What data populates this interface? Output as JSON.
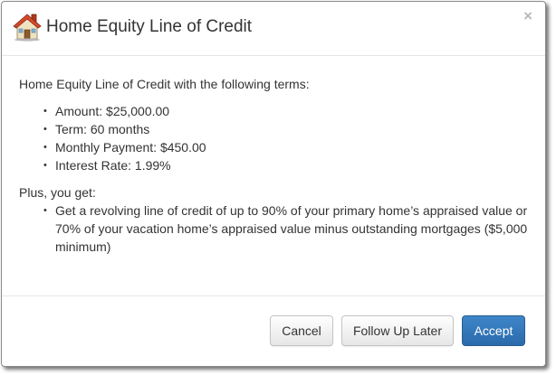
{
  "dialog": {
    "title": "Home Equity Line of Credit",
    "icon": "house-icon",
    "close_label": "×"
  },
  "body": {
    "intro": "Home Equity Line of Credit with the following terms:",
    "terms": [
      "Amount: $25,000.00",
      "Term: 60 months",
      "Monthly Payment: $450.00",
      "Interest Rate: 1.99%"
    ],
    "plus_heading": "Plus, you get:",
    "plus_items": [
      "Get a revolving line of credit of up to 90% of your primary home’s appraised value or 70% of your vacation home’s appraised value minus outstanding mortgages ($5,000 minimum)"
    ]
  },
  "footer": {
    "cancel_label": "Cancel",
    "follow_up_label": "Follow Up Later",
    "accept_label": "Accept"
  },
  "colors": {
    "primary_button": "#337ab7",
    "text": "#333333",
    "close": "#b8b8b8"
  }
}
